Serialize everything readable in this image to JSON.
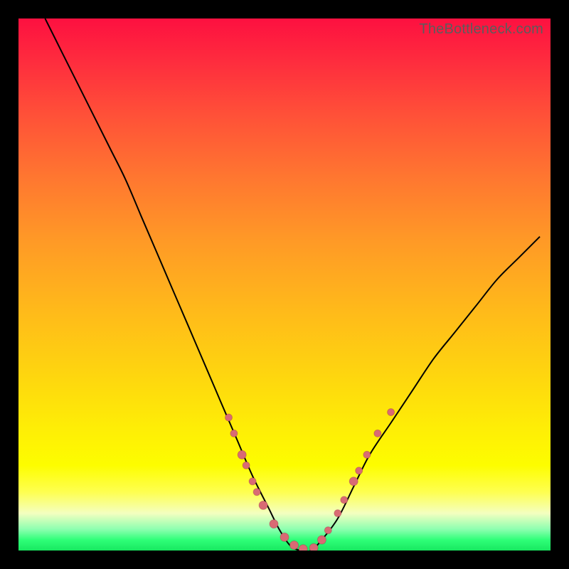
{
  "watermark": "TheBottleneck.com",
  "colors": {
    "frame": "#000000",
    "curve": "#000000",
    "dot": "#d96a74"
  },
  "chart_data": {
    "type": "line",
    "title": "",
    "xlabel": "",
    "ylabel": "",
    "xlim": [
      0,
      100
    ],
    "ylim": [
      0,
      100
    ],
    "grid": false,
    "legend": false,
    "series": [
      {
        "name": "bottleneck-curve",
        "x": [
          5,
          8,
          11,
          14,
          17,
          20,
          23,
          26,
          29,
          32,
          35,
          38,
          41,
          44,
          47,
          49,
          51,
          53,
          55,
          57,
          60,
          63,
          66,
          70,
          74,
          78,
          82,
          86,
          90,
          94,
          98
        ],
        "y": [
          100,
          94,
          88,
          82,
          76,
          70,
          63,
          56,
          49,
          42,
          35,
          28,
          21,
          14,
          8,
          4,
          1,
          0,
          0,
          2,
          6,
          12,
          18,
          24,
          30,
          36,
          41,
          46,
          51,
          55,
          59
        ]
      }
    ],
    "scatter": {
      "name": "sample-dots",
      "points": [
        {
          "x": 39.5,
          "y": 25.0,
          "r": 5
        },
        {
          "x": 40.5,
          "y": 22.0,
          "r": 5
        },
        {
          "x": 42.0,
          "y": 18.0,
          "r": 6
        },
        {
          "x": 42.8,
          "y": 16.0,
          "r": 5
        },
        {
          "x": 44.0,
          "y": 13.0,
          "r": 5
        },
        {
          "x": 44.8,
          "y": 11.0,
          "r": 5
        },
        {
          "x": 46.0,
          "y": 8.5,
          "r": 6
        },
        {
          "x": 48.0,
          "y": 5.0,
          "r": 6
        },
        {
          "x": 50.0,
          "y": 2.5,
          "r": 6
        },
        {
          "x": 51.8,
          "y": 1.0,
          "r": 6
        },
        {
          "x": 53.5,
          "y": 0.3,
          "r": 6
        },
        {
          "x": 55.5,
          "y": 0.5,
          "r": 6
        },
        {
          "x": 57.0,
          "y": 2.0,
          "r": 6
        },
        {
          "x": 58.2,
          "y": 3.8,
          "r": 5
        },
        {
          "x": 60.0,
          "y": 7.0,
          "r": 5
        },
        {
          "x": 61.2,
          "y": 9.5,
          "r": 5
        },
        {
          "x": 63.0,
          "y": 13.0,
          "r": 6
        },
        {
          "x": 64.0,
          "y": 15.0,
          "r": 5
        },
        {
          "x": 65.5,
          "y": 18.0,
          "r": 5
        },
        {
          "x": 67.5,
          "y": 22.0,
          "r": 5
        },
        {
          "x": 70.0,
          "y": 26.0,
          "r": 5
        }
      ]
    }
  }
}
